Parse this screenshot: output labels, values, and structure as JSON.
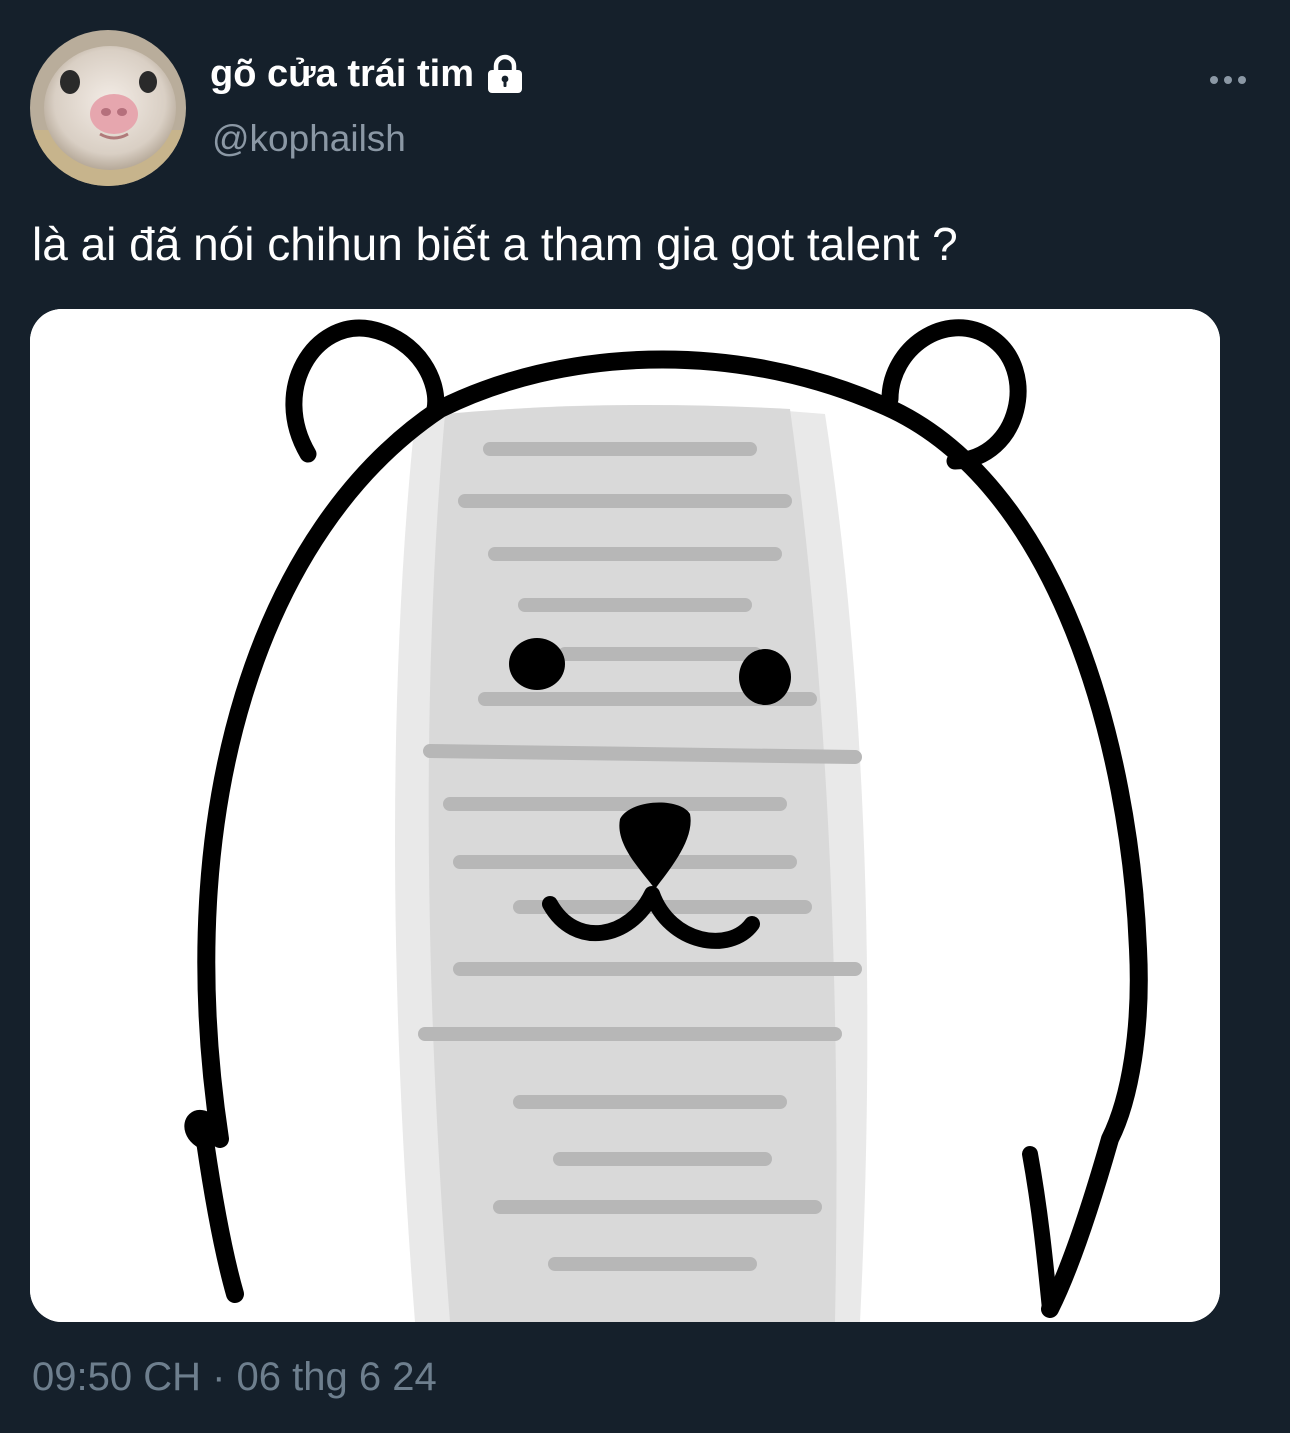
{
  "tweet": {
    "display_name": "gõ cửa trái tim",
    "handle": "@kophailsh",
    "protected": true,
    "text": "là ai đã nói chihun biết a tham gia got talent ?",
    "timestamp": "09:50 CH · 06 thg 6 24"
  },
  "icons": {
    "lock": "lock-icon",
    "more": "more-horizontal-icon"
  },
  "colors": {
    "background": "#15202b",
    "text_primary": "#ffffff",
    "text_secondary": "#8b98a5"
  }
}
